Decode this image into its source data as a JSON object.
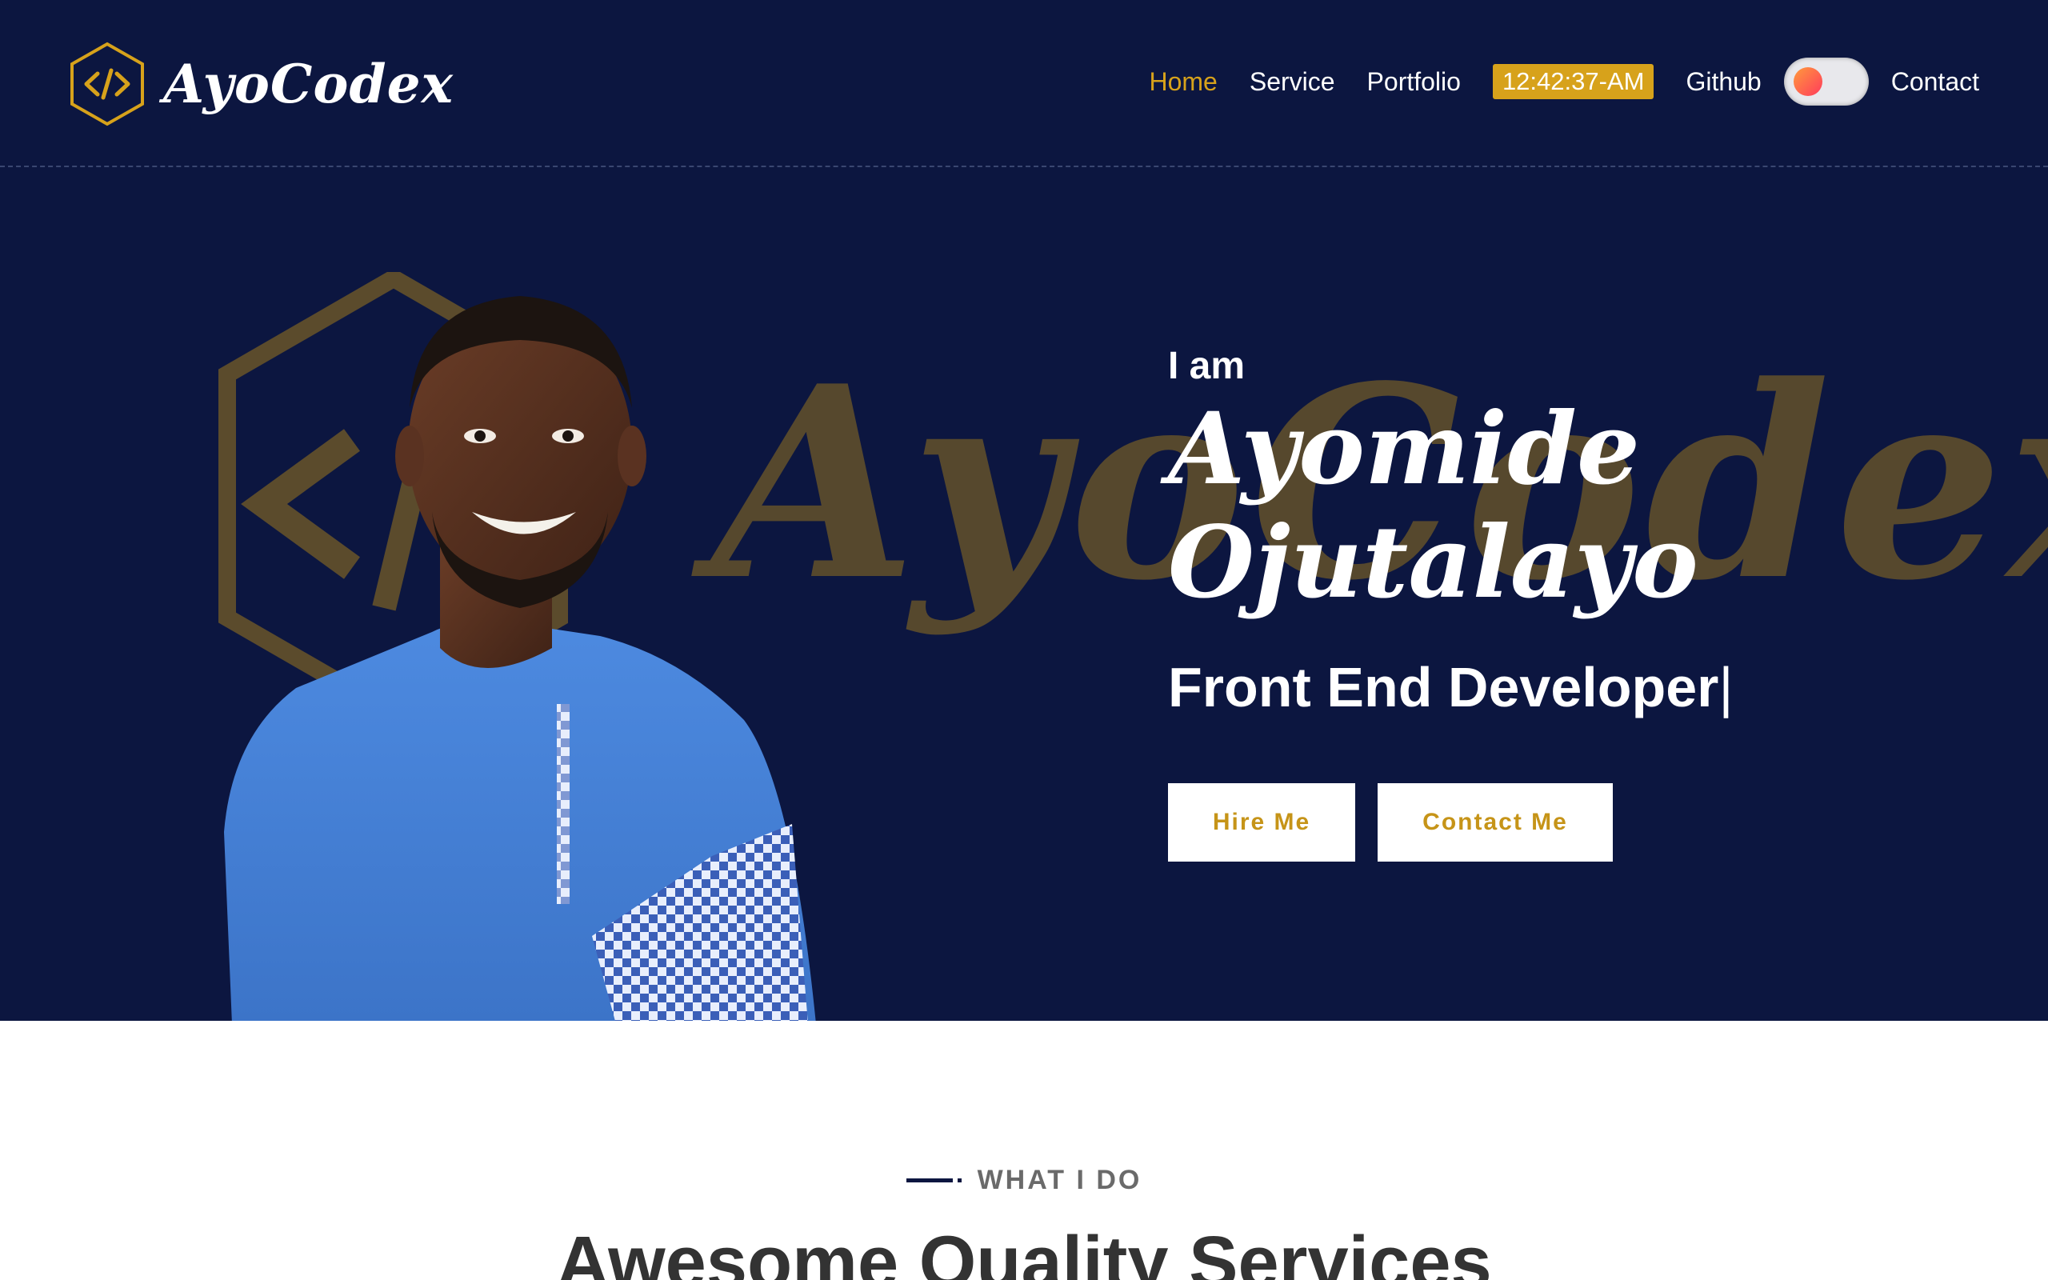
{
  "brand": {
    "name": "AyoCodex",
    "logo_icon": "code-hex-icon"
  },
  "nav": {
    "home": "Home",
    "service": "Service",
    "portfolio": "Portfolio",
    "clock": "12:42:37-AM",
    "github": "Github",
    "contact": "Contact"
  },
  "theme_toggle": {
    "state": "off"
  },
  "hero": {
    "watermark": "AyoCodex",
    "greeting": "I am",
    "first_name": "Ayomide",
    "last_name": "Ojutalayo",
    "role": "Front End Developer",
    "caret": "|",
    "hire_button": "Hire Me",
    "contact_button": "Contact Me"
  },
  "services": {
    "eyebrow": "WHAT I DO",
    "title": "Awesome Quality Services"
  },
  "colors": {
    "navy": "#0c1640",
    "gold": "#d7a21b",
    "white": "#ffffff",
    "gray_text": "#6a6a6a"
  }
}
